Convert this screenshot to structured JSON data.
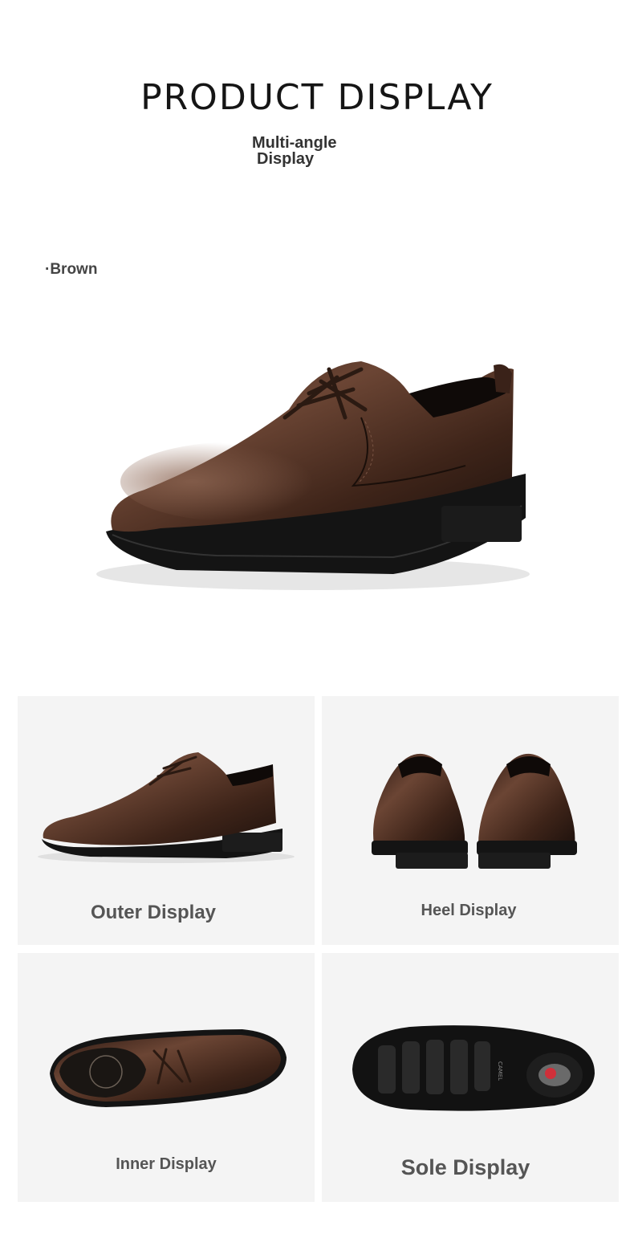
{
  "header": {
    "title": "PRODUCT DISPLAY",
    "subtitle_line1": "Multi-angle",
    "subtitle_line2": "Display"
  },
  "color_option": {
    "label": "·Brown",
    "leather_color": "#4a2c20"
  },
  "gallery": {
    "outer": {
      "label": "Outer Display",
      "icon": "shoe-side-view"
    },
    "heel": {
      "label": "Heel Display",
      "icon": "shoe-heel-view"
    },
    "inner": {
      "label": "Inner Display",
      "icon": "shoe-top-view"
    },
    "sole": {
      "label": "Sole Display",
      "icon": "shoe-sole-view"
    }
  }
}
